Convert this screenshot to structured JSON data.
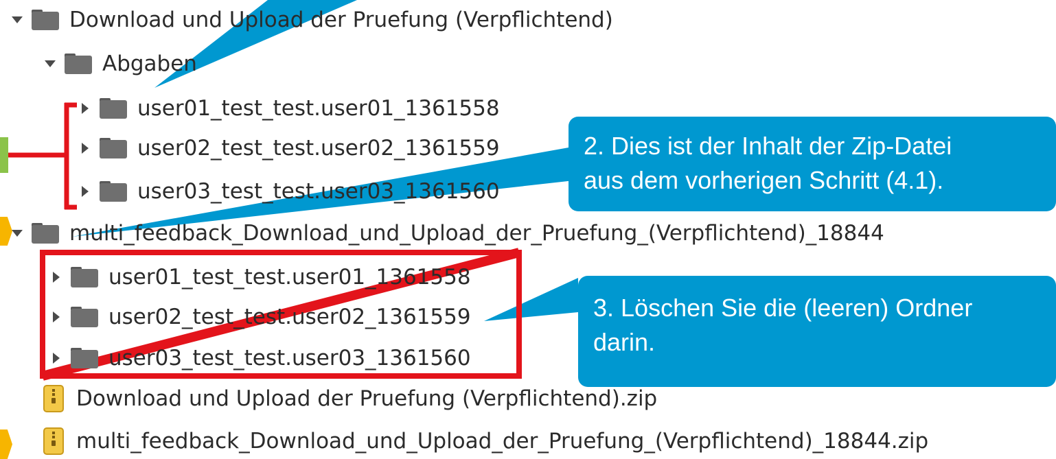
{
  "tree": {
    "items": [
      {
        "label": "Download und Upload der Pruefung (Verpflichtend)",
        "kind": "folder",
        "expanded": true
      },
      {
        "label": "Abgaben",
        "kind": "folder",
        "expanded": true
      },
      {
        "label": "user01_test_test.user01_1361558",
        "kind": "folder",
        "expanded": false
      },
      {
        "label": "user02_test_test.user02_1361559",
        "kind": "folder",
        "expanded": false
      },
      {
        "label": "user03_test_test.user03_1361560",
        "kind": "folder",
        "expanded": false
      },
      {
        "label": "multi_feedback_Download_und_Upload_der_Pruefung_(Verpflichtend)_18844",
        "kind": "folder",
        "expanded": true
      },
      {
        "label": "user01_test_test.user01_1361558",
        "kind": "folder",
        "expanded": false
      },
      {
        "label": "user02_test_test.user02_1361559",
        "kind": "folder",
        "expanded": false
      },
      {
        "label": "user03_test_test.user03_1361560",
        "kind": "folder",
        "expanded": false
      },
      {
        "label": "Download und Upload der Pruefung (Verpflichtend).zip",
        "kind": "zip"
      },
      {
        "label": "multi_feedback_Download_und_Upload_der_Pruefung_(Verpflichtend)_18844.zip",
        "kind": "zip"
      }
    ]
  },
  "callouts": {
    "step2": {
      "line1": "2. Dies ist der Inhalt der Zip-Datei",
      "line2": "aus dem vorherigen Schritt (4.1)."
    },
    "step3": {
      "line1": "3. Löschen Sie die (leeren) Ordner",
      "line2": "darin."
    }
  },
  "colors": {
    "callout": "#0098d0",
    "highlight": "#e3141b",
    "folder": "#6f6f6f",
    "zip": "#f3c948",
    "text": "#2b2b2b"
  },
  "icons": {
    "expanded": "triangle-down-icon",
    "collapsed": "triangle-right-icon",
    "folder": "folder-icon",
    "zip": "zip-archive-icon"
  }
}
